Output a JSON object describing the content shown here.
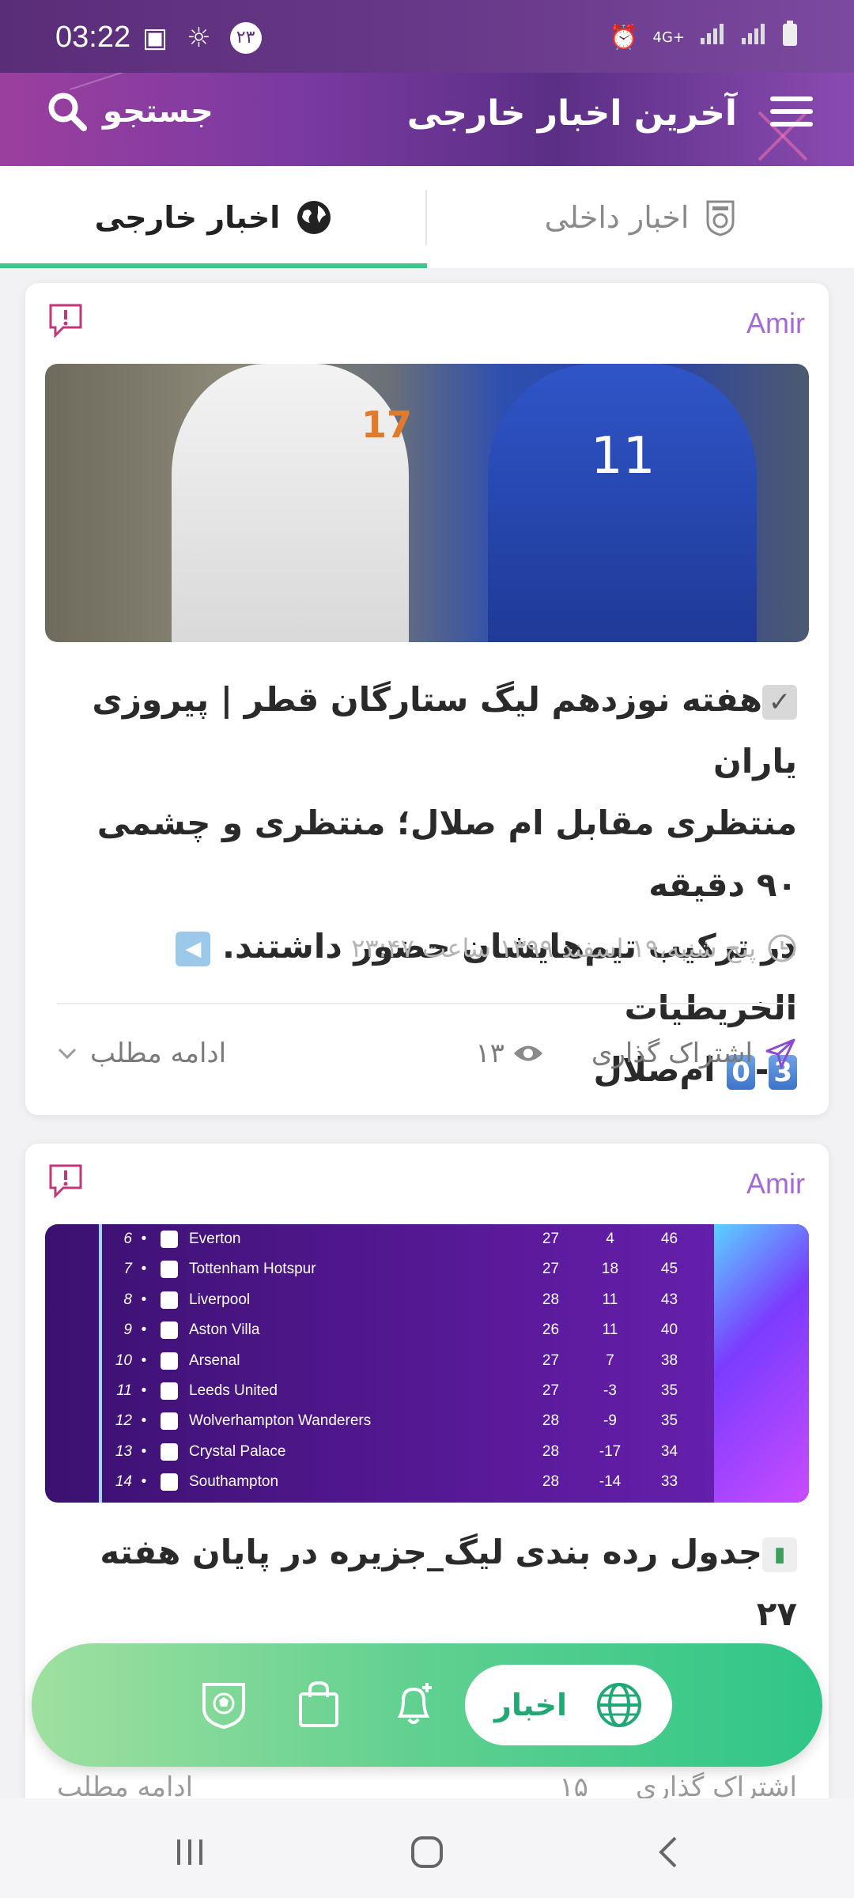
{
  "status_bar": {
    "time": "03:22",
    "badge_number": "۲۳",
    "network": "4G+"
  },
  "header": {
    "title": "آخرین اخبار خارجی",
    "search_label": "جستجو"
  },
  "tabs": [
    {
      "label": "اخبار داخلی",
      "active": false,
      "icon": "soccer-shield-icon"
    },
    {
      "label": "اخبار خارجی",
      "active": true,
      "icon": "globe-icon"
    }
  ],
  "cards": [
    {
      "author": "Amir",
      "text_line1": "هفته نوزدهم لیگ ستارگان قطر | پیروزی یاران",
      "text_line2": "منتظری مقابل ام صلال؛ منتظری و چشمی ۹۰ دقیقه",
      "text_line3": "در ترکیب تیم‌هایشان حضور داشتند.",
      "text_line3b": "الخریطیات",
      "score_home": "3",
      "score_sep": "-",
      "score_away": "0",
      "text_line4_end": "ام‌صلال",
      "date": "پنج شنبه،۱۹ اسفند ۱۳۹۹ ساعت ۲۳:۴۷",
      "share_label": "اشتراک گذاری",
      "views": "۱۳",
      "more_label": "ادامه مطلب"
    },
    {
      "author": "Amir",
      "text_line1": "جدول رده بندی لیگ_جزیره در پایان هفته ۲۷",
      "share_label": "اشتراک گذاری",
      "views": "۱۵",
      "more_label": "ادامه مطلب",
      "league_table": [
        {
          "pos": "6",
          "team": "Everton",
          "played": "27",
          "gd": "4",
          "pts": "46"
        },
        {
          "pos": "7",
          "team": "Tottenham Hotspur",
          "played": "27",
          "gd": "18",
          "pts": "45"
        },
        {
          "pos": "8",
          "team": "Liverpool",
          "played": "28",
          "gd": "11",
          "pts": "43"
        },
        {
          "pos": "9",
          "team": "Aston Villa",
          "played": "26",
          "gd": "11",
          "pts": "40"
        },
        {
          "pos": "10",
          "team": "Arsenal",
          "played": "27",
          "gd": "7",
          "pts": "38"
        },
        {
          "pos": "11",
          "team": "Leeds United",
          "played": "27",
          "gd": "-3",
          "pts": "35"
        },
        {
          "pos": "12",
          "team": "Wolverhampton Wanderers",
          "played": "28",
          "gd": "-9",
          "pts": "35"
        },
        {
          "pos": "13",
          "team": "Crystal Palace",
          "played": "28",
          "gd": "-17",
          "pts": "34"
        },
        {
          "pos": "14",
          "team": "Southampton",
          "played": "28",
          "gd": "-14",
          "pts": "33"
        }
      ]
    }
  ],
  "bottom_nav": {
    "active_label": "اخبار",
    "items": [
      "globe-icon",
      "bell-plus-icon",
      "shopping-bag-icon",
      "soccer-shield-icon"
    ]
  },
  "colors": {
    "header_purple": "#7a3aa0",
    "accent_green": "#3cc68a",
    "author_purple": "#a56ad1"
  }
}
